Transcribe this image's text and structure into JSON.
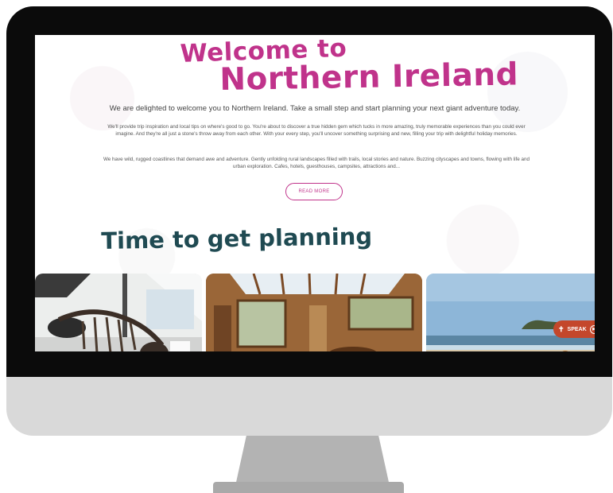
{
  "hero": {
    "headline_line1": "Welcome to",
    "headline_line2": "Northern Ireland",
    "intro": "We are delighted to welcome you to Northern Ireland. Take a small step and start planning your next giant adventure today.",
    "paragraph1": "We'll provide trip inspiration and local tips on where's good to go. You're about to discover a true hidden gem which tucks in more amazing, truly memorable experiences than you could ever imagine. And they're all just a stone's throw away from each other. With your every step, you'll uncover something surprising and new, filling your trip with delightful holiday memories.",
    "paragraph2": "We have wild, rugged coastlines that demand awe and adventure. Gently unfolding rural landscapes filled with trails, local stories and nature. Buzzing cityscapes and towns, flowing with life and urban exploration. Cafes, hotels, guesthouses, campsites, attractions and...",
    "read_more_label": "READ MORE"
  },
  "planning": {
    "title": "Time to get planning"
  },
  "speak_widget": {
    "label": "SPEAK",
    "person_icon": "accessibility-person-icon",
    "play_icon": "play-circle-icon"
  },
  "colors": {
    "brand_pink": "#c0338b",
    "section_teal": "#1f4a52",
    "speak_orange": "#c4472b",
    "monitor_bezel": "#0b0b0b",
    "monitor_chin": "#d9d9d9"
  }
}
